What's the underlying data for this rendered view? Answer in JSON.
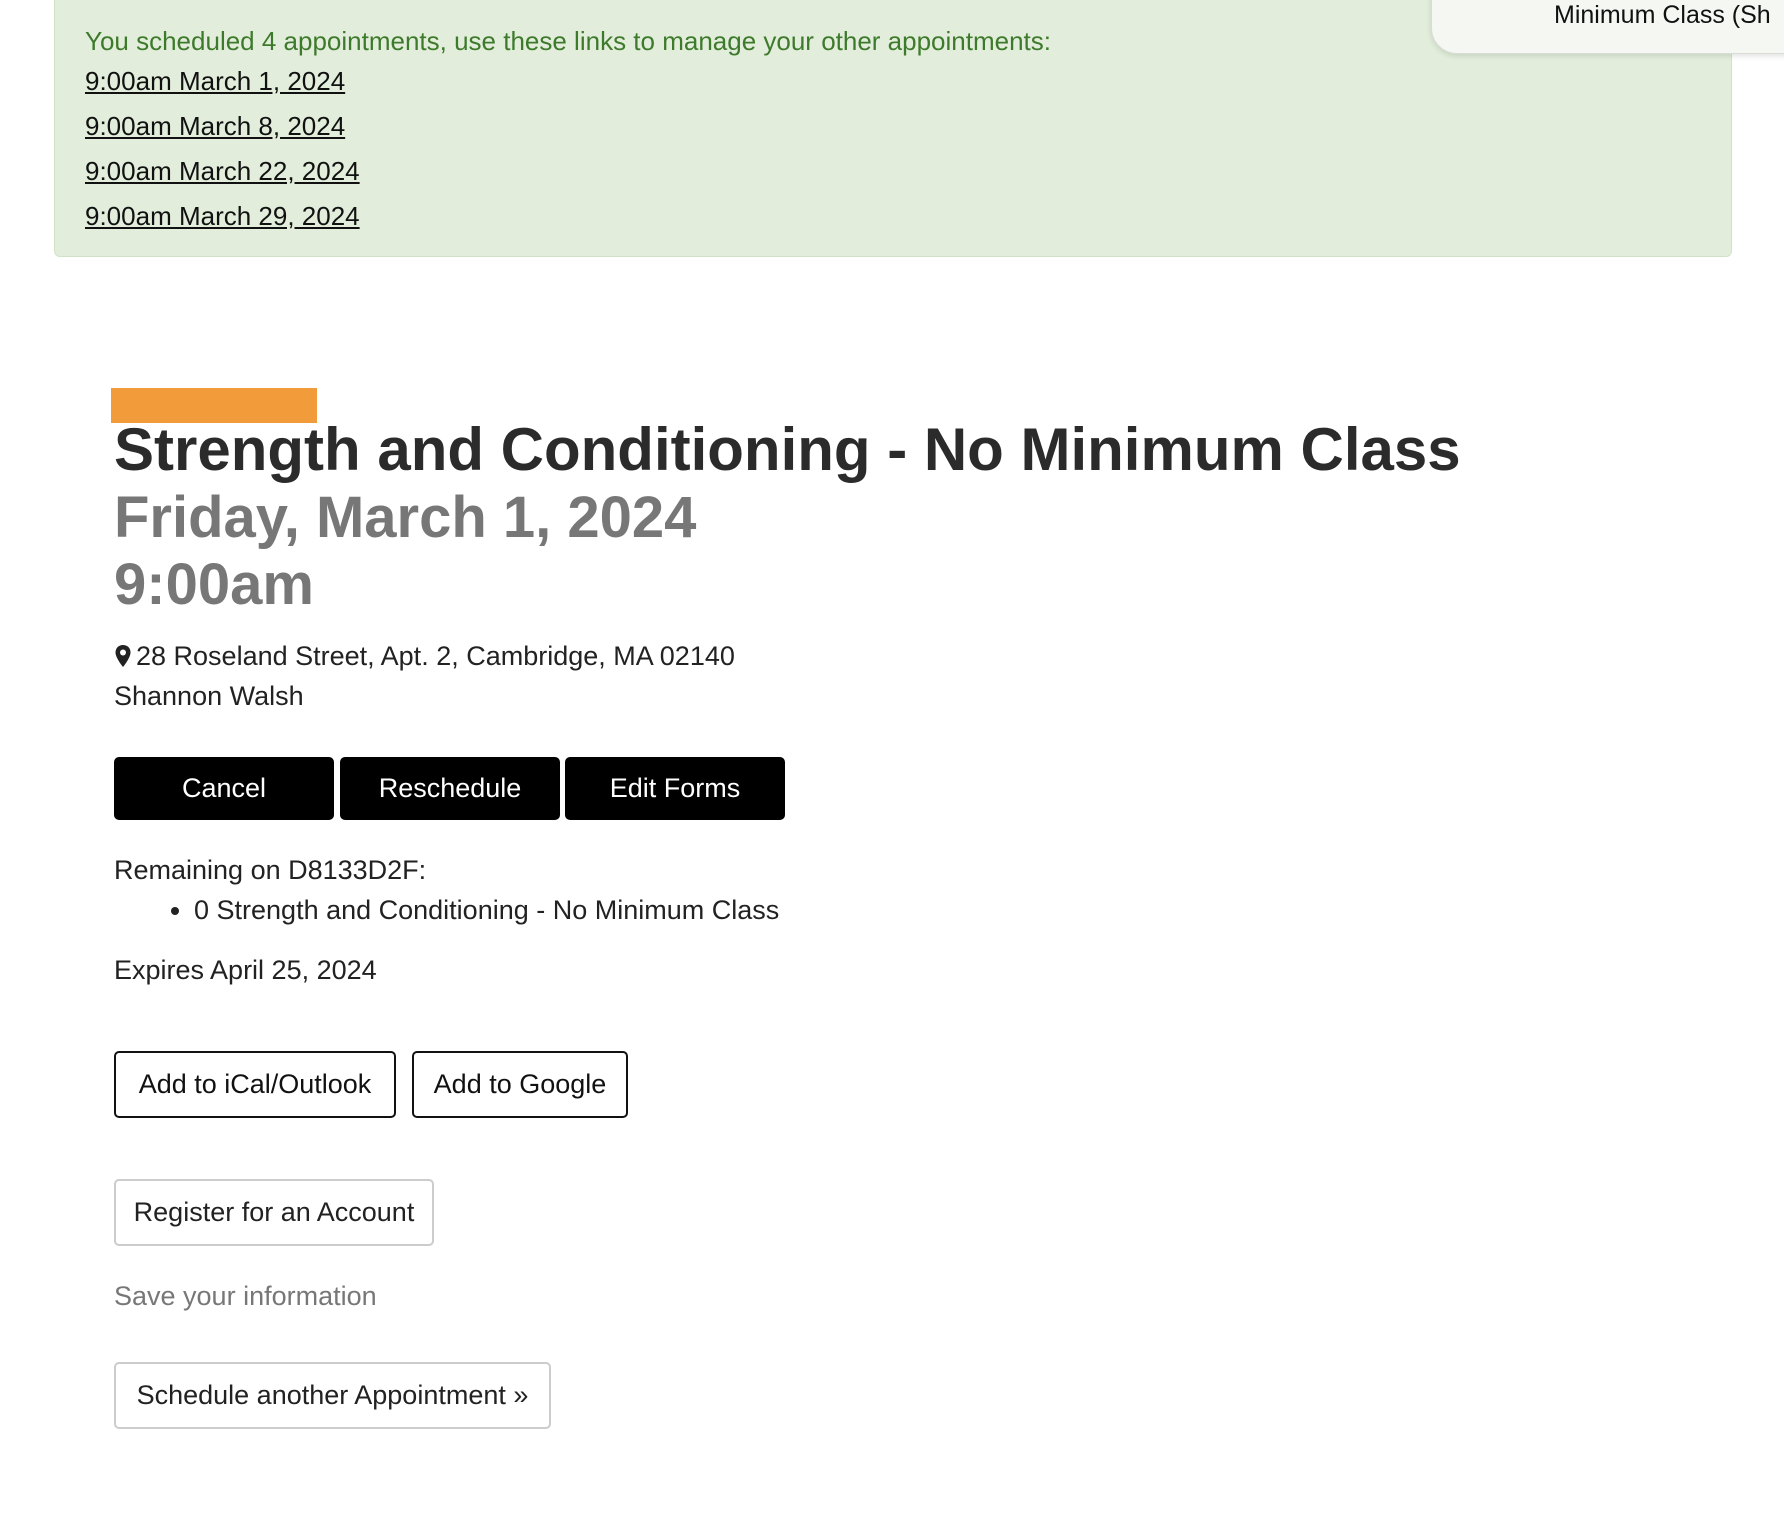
{
  "banner": {
    "message": "You scheduled 4 appointments, use these links to manage your other appointments:",
    "links": [
      "9:00am March 1, 2024",
      "9:00am March 8, 2024",
      "9:00am March 22, 2024",
      "9:00am March 29, 2024"
    ],
    "background_color": "#e2eedb",
    "text_color": "#3e7a2c"
  },
  "toast": {
    "text": "Minimum Class (Sh"
  },
  "event": {
    "tag_color": "#f29b3a",
    "title": "Strength and Conditioning - No Minimum Class",
    "date": "Friday, March 1, 2024",
    "time": "9:00am",
    "location_icon": "map-pin-icon",
    "location": "28 Roseland Street, Apt. 2, Cambridge, MA 02140",
    "instructor": "Shannon Walsh"
  },
  "actions": {
    "cancel": "Cancel",
    "reschedule": "Reschedule",
    "edit_forms": "Edit Forms"
  },
  "package": {
    "remaining_label": "Remaining on D8133D2F:",
    "items": [
      "0 Strength and Conditioning - No Minimum Class"
    ],
    "expires": "Expires April 25, 2024"
  },
  "calendar": {
    "ical": "Add to iCal/Outlook",
    "google": "Add to Google"
  },
  "account": {
    "register": "Register for an Account",
    "save_info": "Save your information"
  },
  "schedule_another": "Schedule another Appointment »"
}
